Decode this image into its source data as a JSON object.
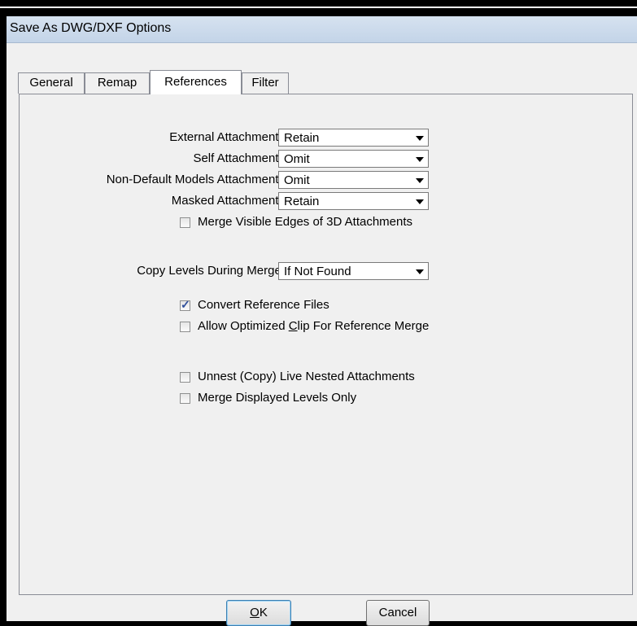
{
  "window": {
    "title": "Save As DWG/DXF Options"
  },
  "tabs": [
    {
      "label": "General",
      "active": false
    },
    {
      "label": "Remap",
      "active": false
    },
    {
      "label": "References",
      "active": true
    },
    {
      "label": "Filter",
      "active": false
    }
  ],
  "references": {
    "external": {
      "label": "External Attachments",
      "value": "Retain"
    },
    "self": {
      "label": "Self Attachments",
      "value": "Omit"
    },
    "non_default": {
      "label": "Non-Default Models Attachments",
      "value": "Omit"
    },
    "masked": {
      "label": "Masked Attachments",
      "value": "Retain"
    },
    "merge_3d": {
      "label": "Merge Visible Edges of 3D Attachments",
      "checked": false
    },
    "copy_levels": {
      "label": "Copy Levels During Merge:",
      "value": "If Not Found"
    },
    "convert_ref": {
      "label": "Convert Reference Files",
      "checked": true
    },
    "allow_clip": {
      "label_pre": "Allow Optimized ",
      "label_mnemonic": "C",
      "label_post": "lip For Reference Merge",
      "checked": false
    },
    "unnest": {
      "label": "Unnest (Copy) Live Nested Attachments",
      "checked": false
    },
    "merge_displayed": {
      "label": "Merge Displayed Levels Only",
      "checked": false
    }
  },
  "buttons": {
    "ok_mnemonic": "O",
    "ok_rest": "K",
    "cancel": "Cancel"
  }
}
